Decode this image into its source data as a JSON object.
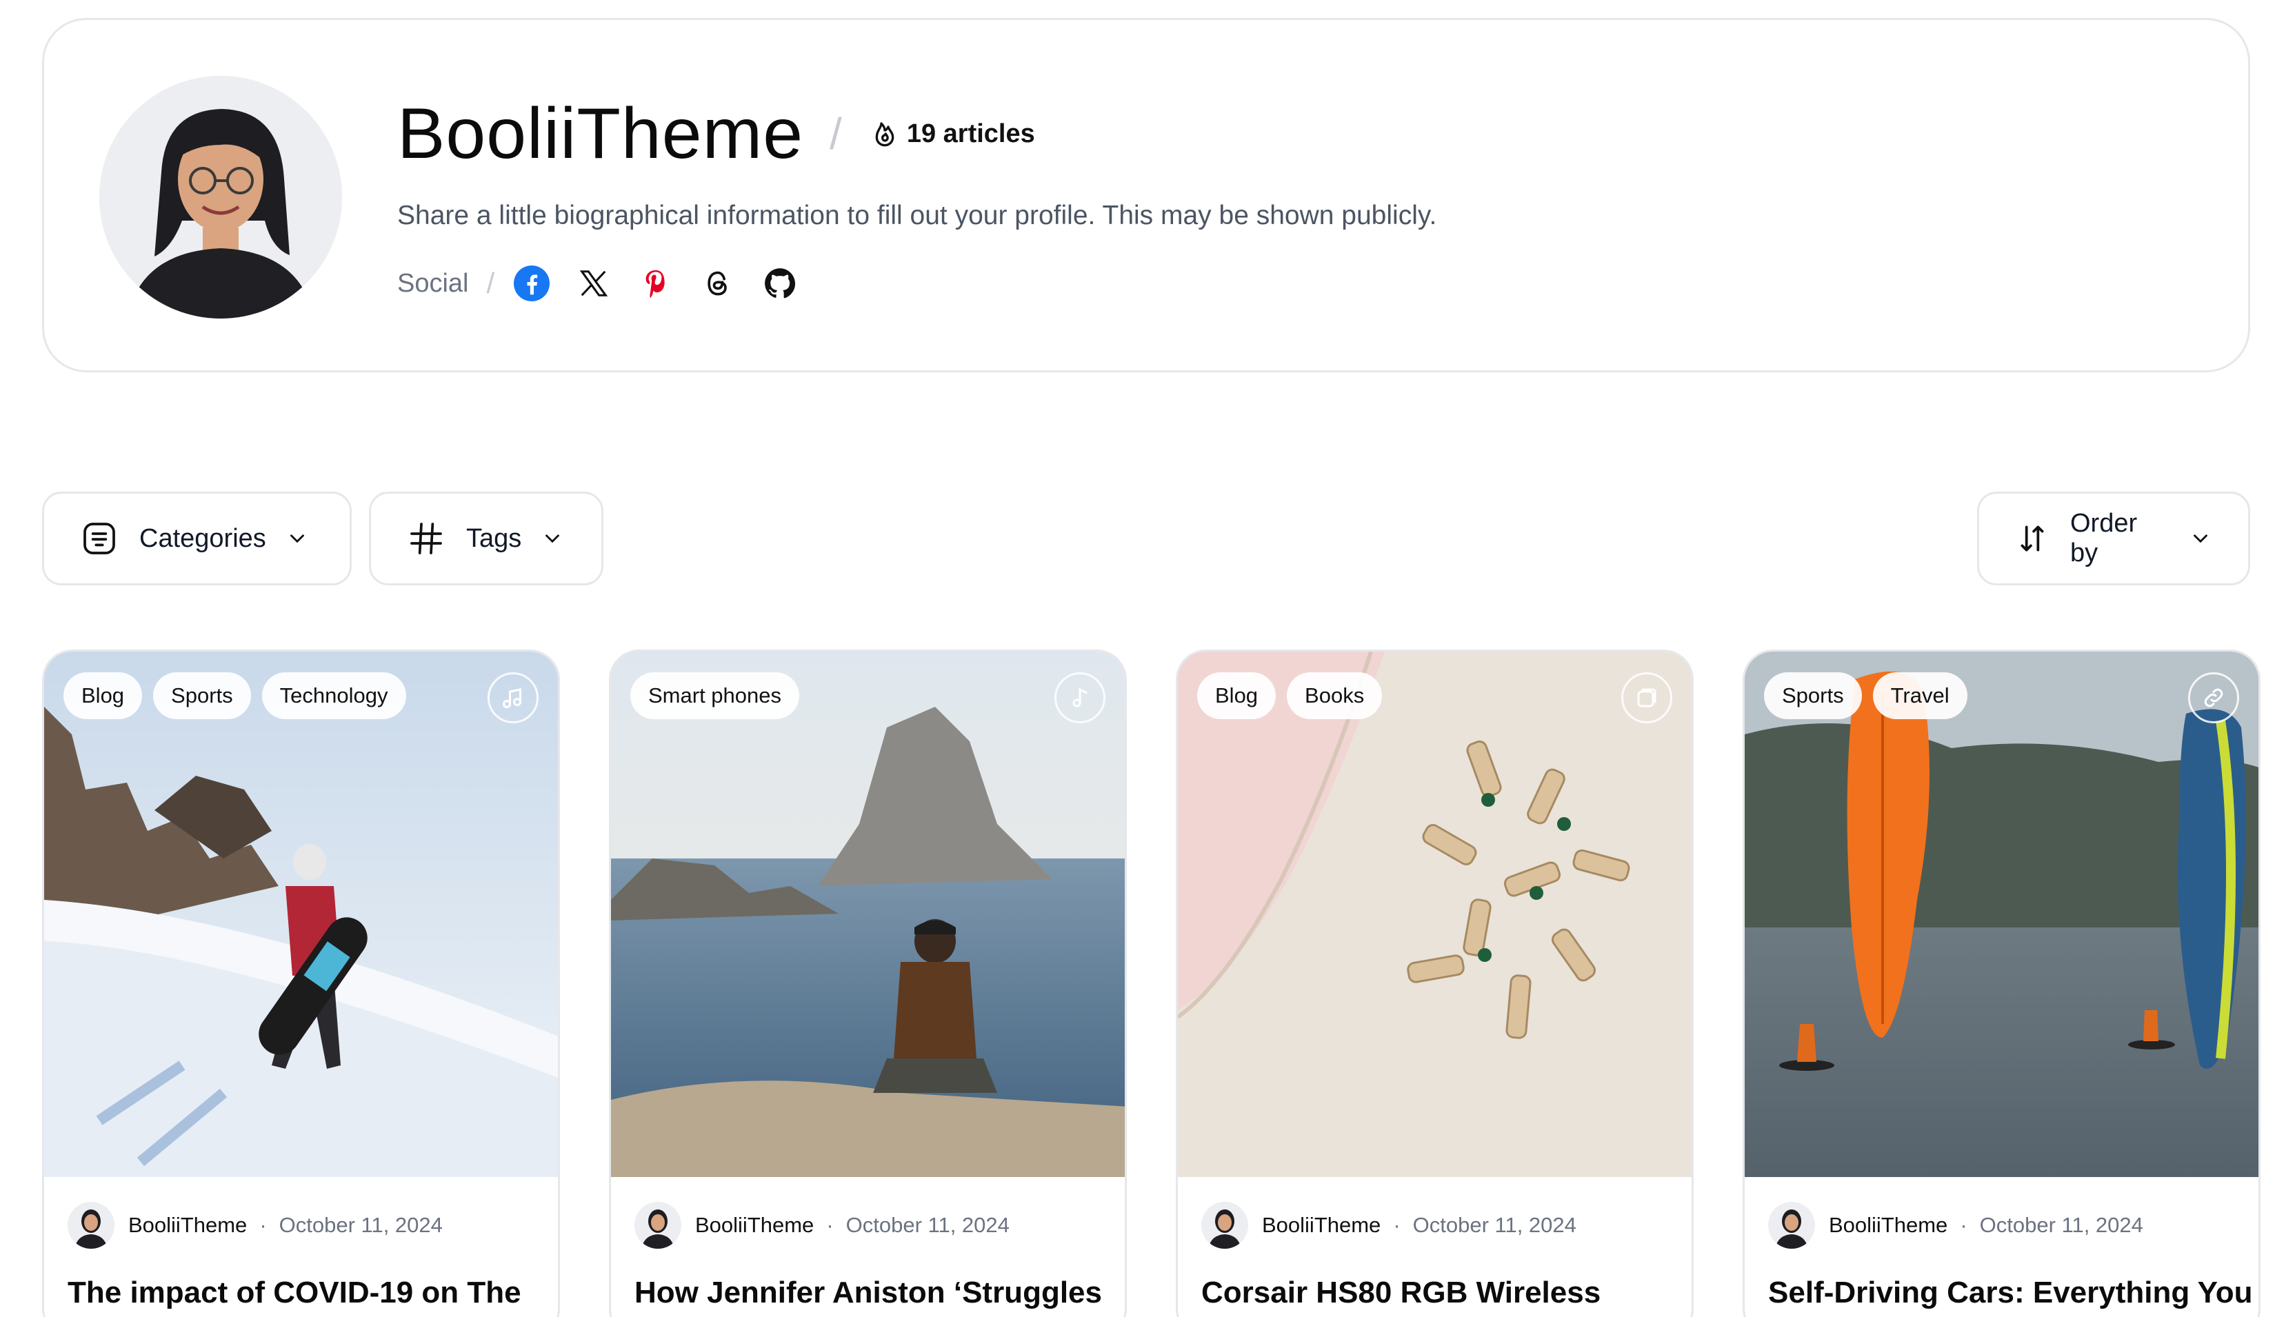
{
  "profile": {
    "name": "BooliiTheme",
    "articles_count": "19 articles",
    "bio": "Share a little biographical information to fill out your profile. This may be shown publicly.",
    "social_label": "Social",
    "social_icons": [
      "facebook-icon",
      "x-icon",
      "pinterest-icon",
      "threads-icon",
      "github-icon"
    ]
  },
  "filters": {
    "categories_label": "Categories",
    "tags_label": "Tags",
    "order_label": "Order by"
  },
  "posts": [
    {
      "tags": [
        "Blog",
        "Sports",
        "Technology"
      ],
      "format_icon": "audio-icon",
      "author": "BooliiTheme",
      "date": "October 11, 2024",
      "title": "The impact of COVID-19 on The"
    },
    {
      "tags": [
        "Smart phones"
      ],
      "format_icon": "music-icon",
      "author": "BooliiTheme",
      "date": "October 11, 2024",
      "title": "How Jennifer Aniston ‘Struggles"
    },
    {
      "tags": [
        "Blog",
        "Books"
      ],
      "format_icon": "gallery-icon",
      "author": "BooliiTheme",
      "date": "October 11, 2024",
      "title": "Corsair HS80 RGB Wireless"
    },
    {
      "tags": [
        "Sports",
        "Travel"
      ],
      "format_icon": "link-icon",
      "author": "BooliiTheme",
      "date": "October 11, 2024",
      "title": "Self-Driving Cars: Everything You"
    }
  ],
  "colors": {
    "facebook": "#1877f2",
    "pinterest": "#e60023",
    "border": "#e5e7eb",
    "muted": "#6b7280"
  }
}
